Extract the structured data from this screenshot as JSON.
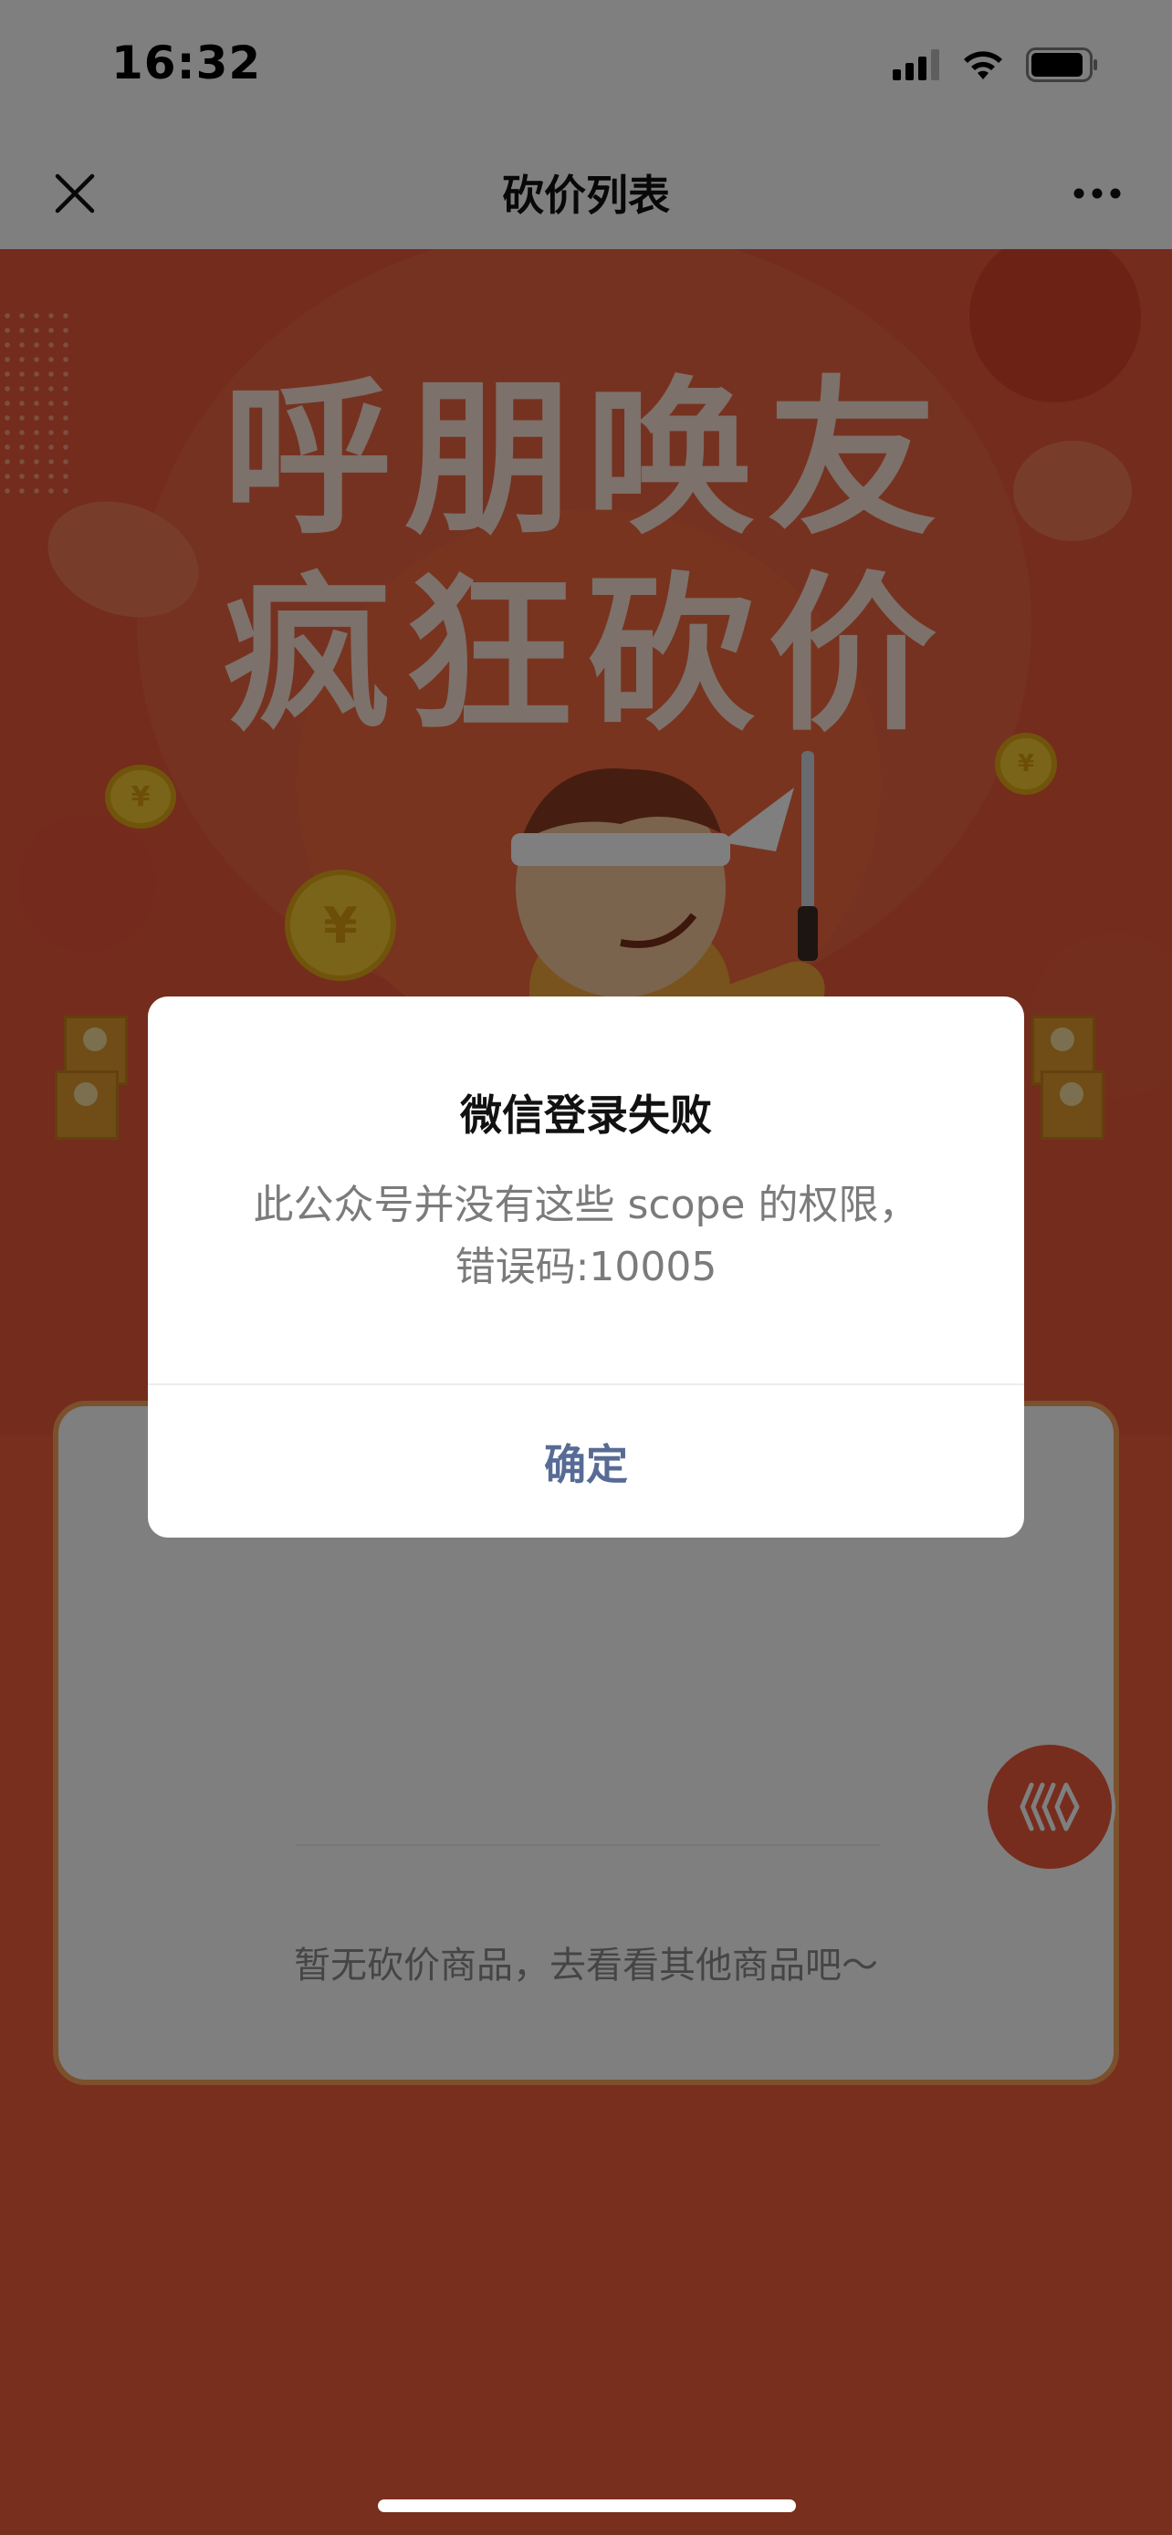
{
  "status_bar": {
    "time": "16:32",
    "signal_icon": "cellular-signal-icon",
    "wifi_icon": "wifi-icon",
    "battery_icon": "battery-icon"
  },
  "nav_bar": {
    "title": "砍价列表",
    "close_icon": "close-icon",
    "more_icon": "more-dots-icon"
  },
  "banner": {
    "slogan_line1": "呼朋唤友",
    "slogan_line2": "疯狂砍价",
    "coin_symbol": "¥"
  },
  "list": {
    "empty_text": "暂无砍价商品，去看看其他商品吧～"
  },
  "floating_button": {
    "icon": "brand-logo-icon"
  },
  "dialog": {
    "title": "微信登录失败",
    "message_line1": "此公众号并没有这些 scope 的权限，",
    "message_line2": "错误码:10005",
    "confirm_label": "确定"
  },
  "colors": {
    "banner_bg": "#e8583b",
    "dialog_button": "#576b95",
    "overlay": "rgba(0,0,0,0.5)"
  }
}
